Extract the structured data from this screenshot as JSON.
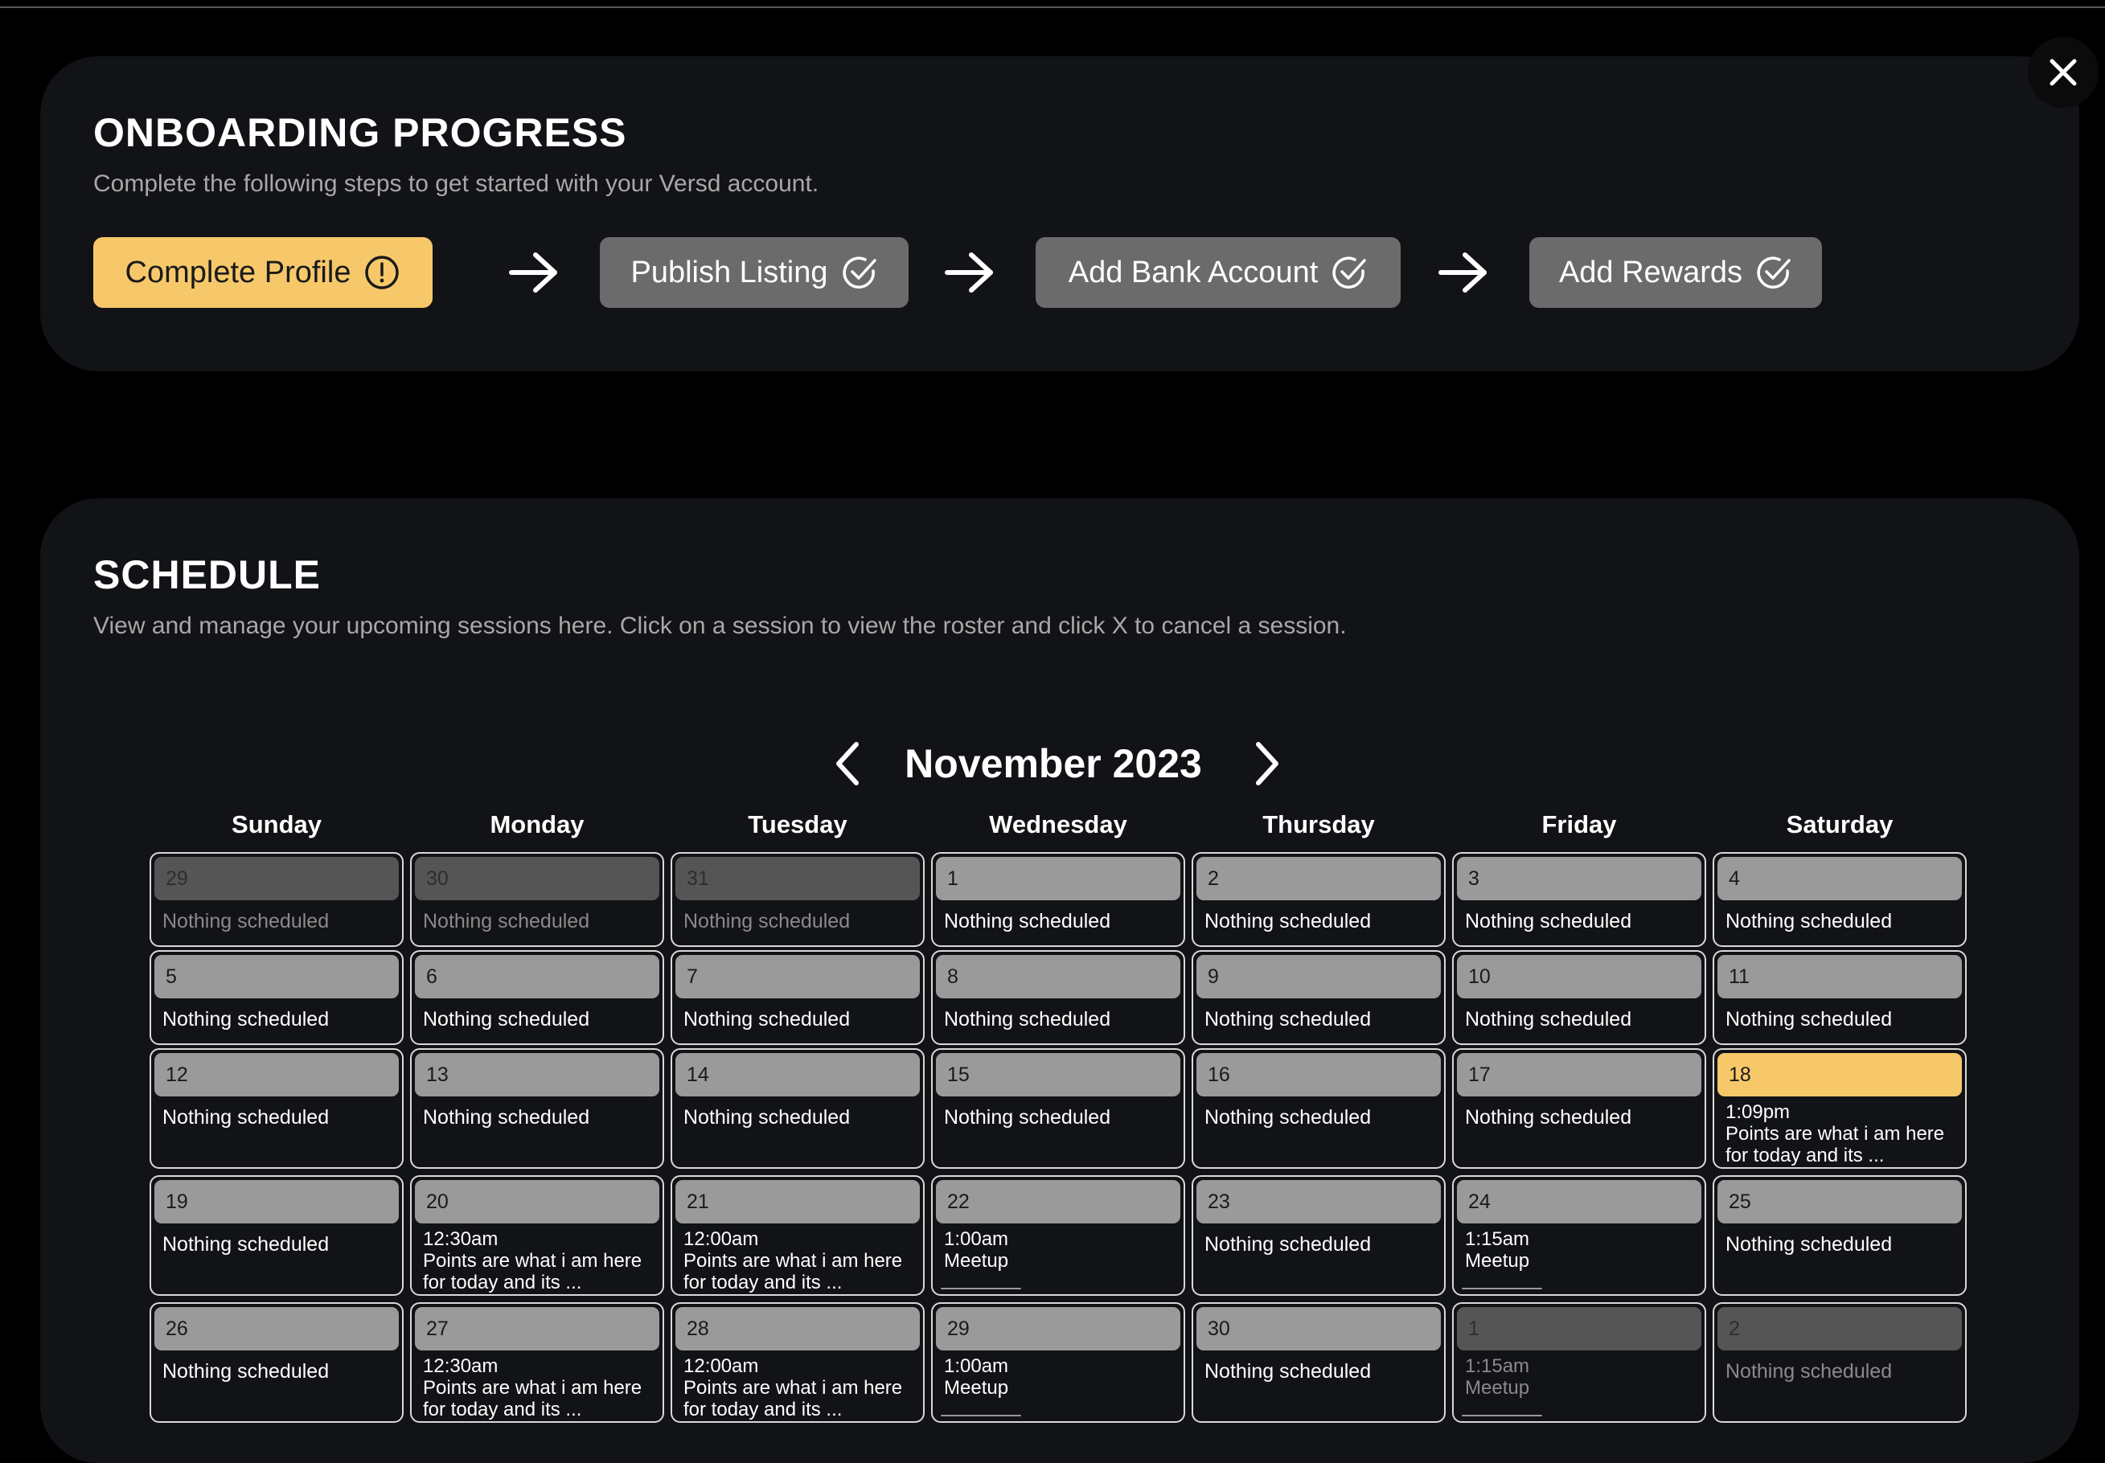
{
  "onboarding": {
    "title": "ONBOARDING PROGRESS",
    "subtitle": "Complete the following steps to get started with your Versd account.",
    "steps": [
      {
        "label": "Complete Profile",
        "status": "incomplete",
        "icon": "alert-circle-icon"
      },
      {
        "label": "Publish Listing",
        "status": "complete",
        "icon": "check-circle-icon"
      },
      {
        "label": "Add Bank Account",
        "status": "complete",
        "icon": "check-circle-icon"
      },
      {
        "label": "Add Rewards",
        "status": "complete",
        "icon": "check-circle-icon"
      }
    ]
  },
  "close_icon": "close-icon",
  "schedule": {
    "title": "SCHEDULE",
    "subtitle": "View and manage your upcoming sessions here. Click on a session to view the roster and click X to cancel a session.",
    "month_label": "November 2023",
    "weekdays": [
      "Sunday",
      "Monday",
      "Tuesday",
      "Wednesday",
      "Thursday",
      "Friday",
      "Saturday"
    ],
    "empty_label": "Nothing scheduled",
    "weeks": [
      [
        {
          "day": "29",
          "other": true
        },
        {
          "day": "30",
          "other": true
        },
        {
          "day": "31",
          "other": true
        },
        {
          "day": "1"
        },
        {
          "day": "2"
        },
        {
          "day": "3"
        },
        {
          "day": "4"
        }
      ],
      [
        {
          "day": "5"
        },
        {
          "day": "6"
        },
        {
          "day": "7"
        },
        {
          "day": "8"
        },
        {
          "day": "9"
        },
        {
          "day": "10"
        },
        {
          "day": "11"
        }
      ],
      [
        {
          "day": "12"
        },
        {
          "day": "13"
        },
        {
          "day": "14"
        },
        {
          "day": "15"
        },
        {
          "day": "16"
        },
        {
          "day": "17"
        },
        {
          "day": "18",
          "today": true,
          "event": {
            "time": "1:09pm",
            "desc": "Points are what i am here for today and its ..."
          }
        }
      ],
      [
        {
          "day": "19"
        },
        {
          "day": "20",
          "event": {
            "time": "12:30am",
            "desc": "Points are what i am here for today and its ..."
          }
        },
        {
          "day": "21",
          "event": {
            "time": "12:00am",
            "desc": "Points are what i am here for today and its ..."
          }
        },
        {
          "day": "22",
          "event": {
            "time": "1:00am",
            "desc": "Meetup"
          }
        },
        {
          "day": "23"
        },
        {
          "day": "24",
          "event": {
            "time": "1:15am",
            "desc": "Meetup"
          }
        },
        {
          "day": "25"
        }
      ],
      [
        {
          "day": "26"
        },
        {
          "day": "27",
          "event": {
            "time": "12:30am",
            "desc": "Points are what i am here for today and its ..."
          }
        },
        {
          "day": "28",
          "event": {
            "time": "12:00am",
            "desc": "Points are what i am here for today and its ..."
          }
        },
        {
          "day": "29",
          "event": {
            "time": "1:00am",
            "desc": "Meetup"
          }
        },
        {
          "day": "30"
        },
        {
          "day": "1",
          "other": true,
          "event": {
            "time": "1:15am",
            "desc": "Meetup"
          }
        },
        {
          "day": "2",
          "other": true
        }
      ]
    ]
  },
  "colors": {
    "accent": "#f7c86a",
    "panel": "#121316",
    "step_done": "#6b6b6b",
    "day_bar": "#9a9a9a",
    "day_bar_other": "#555555"
  }
}
